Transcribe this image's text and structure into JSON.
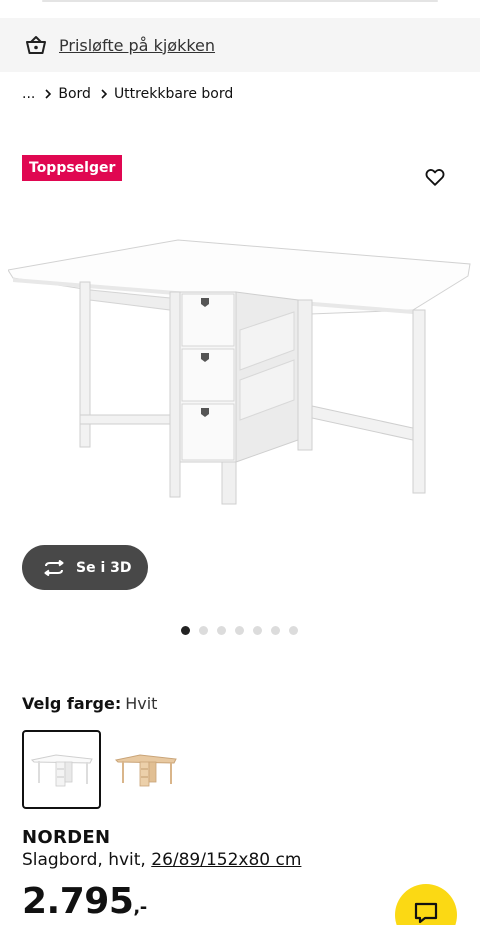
{
  "promo": {
    "text": "Prisløfte på kjøkken",
    "icon": "basket-icon"
  },
  "breadcrumb": {
    "ellipsis": "...",
    "items": [
      "Bord",
      "Uttrekkbare bord"
    ]
  },
  "badge": {
    "text": "Toppselger",
    "color": "#e00751"
  },
  "favorite": {
    "icon": "heart-icon"
  },
  "image_carousel": {
    "dots_total": 7,
    "active_index": 0
  },
  "view_3d": {
    "label": "Se i 3D",
    "icon": "rotate-3d-icon"
  },
  "color_selector": {
    "label": "Velg farge:",
    "selected_value": "Hvit",
    "options": [
      {
        "name": "white-table-swatch",
        "selected": true
      },
      {
        "name": "birch-table-swatch",
        "selected": false
      }
    ]
  },
  "product": {
    "name": "NORDEN",
    "description": "Slagbord, hvit, ",
    "dimensions": "26/89/152x80 cm",
    "price_main": "2.795",
    "price_suffix": ",-"
  },
  "chat": {
    "icon": "chat-icon",
    "color": "#fbd914"
  }
}
